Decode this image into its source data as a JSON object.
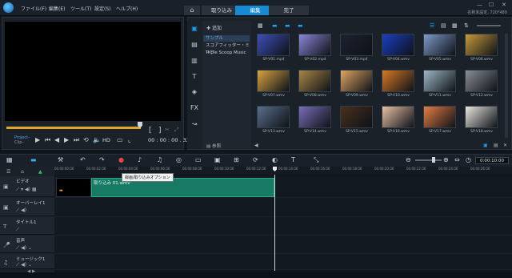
{
  "menu": {
    "items": [
      "ファイル(F)",
      "編集(E)",
      "ツール(T)",
      "設定(S)",
      "ヘルプ(H)"
    ]
  },
  "window": {
    "project_name": "名称未設定, 720*480",
    "minimize": "—",
    "maximize": "☐",
    "close": "✕"
  },
  "modes": {
    "home_icon": "⌂",
    "capture": "取り込み",
    "edit": "編集",
    "share": "完了",
    "active": "edit"
  },
  "preview": {
    "project_label": "Project–",
    "clip_label": "Clip–",
    "hd_label": "HD",
    "timecode": "00 : 00 : 00 . 325",
    "trim_in": "[",
    "trim_out": "]"
  },
  "library": {
    "add_label": "追加",
    "folders": [
      "サンプル",
      "スコアフィッター・ミュー",
      "Triple Scoop Music"
    ],
    "selected_folder": "サンプル",
    "browse_label": "参照",
    "items": [
      {
        "name": "SP-V01.mp4",
        "color": "#3e4fb8"
      },
      {
        "name": "SP-V02.mp4",
        "color": "#8d86d8"
      },
      {
        "name": "SP-V03.mp4",
        "color": "#1d2230"
      },
      {
        "name": "SP-V04.wmv",
        "color": "#1b3ec2"
      },
      {
        "name": "SP-V05.wmv",
        "color": "#7e9bc9"
      },
      {
        "name": "SP-V06.wmv",
        "color": "#c59a3a"
      },
      {
        "name": "SP-V07.wmv",
        "color": "#d9a341"
      },
      {
        "name": "SP-V08.wmv",
        "color": "#a88646"
      },
      {
        "name": "SP-V09.wmv",
        "color": "#e0a561"
      },
      {
        "name": "SP-V10.wmv",
        "color": "#d67a25"
      },
      {
        "name": "SP-V11.wmv",
        "color": "#9fb7c6"
      },
      {
        "name": "SP-V12.wmv",
        "color": "#8a8f95"
      },
      {
        "name": "SP-V13.wmv",
        "color": "#5a6e8c"
      },
      {
        "name": "SP-V14.wmv",
        "color": "#7a6db7"
      },
      {
        "name": "SP-V15.wmv",
        "color": "#4a2f1c"
      },
      {
        "name": "SP-V16.wmv",
        "color": "#e8c0a5"
      },
      {
        "name": "SP-V17.wmv",
        "color": "#e47c44"
      },
      {
        "name": "SP-V18.wmv",
        "color": "#e9e6e0"
      }
    ]
  },
  "timeline": {
    "duration": "0:00:10:00",
    "ruler_ticks": [
      "00:00:00:00",
      "00:00:02:00",
      "00:00:04:00",
      "00:00:06:00",
      "00:00:08:00",
      "00:00:10:00",
      "00:00:12:00",
      "00:00:14:00",
      "00:00:16:00",
      "00:00:18:00",
      "00:00:20:00",
      "00:00:22:00",
      "00:00:24:00",
      "00:00:26:00"
    ],
    "tooltip": "録画/取り込みオプション",
    "tracks": [
      {
        "name": "ビデオ"
      },
      {
        "name": "オーバーレイ1"
      },
      {
        "name": "タイトル1"
      },
      {
        "name": "音声"
      },
      {
        "name": "ミュージック1"
      }
    ],
    "clip_name": "取り込み 01.wmv"
  }
}
